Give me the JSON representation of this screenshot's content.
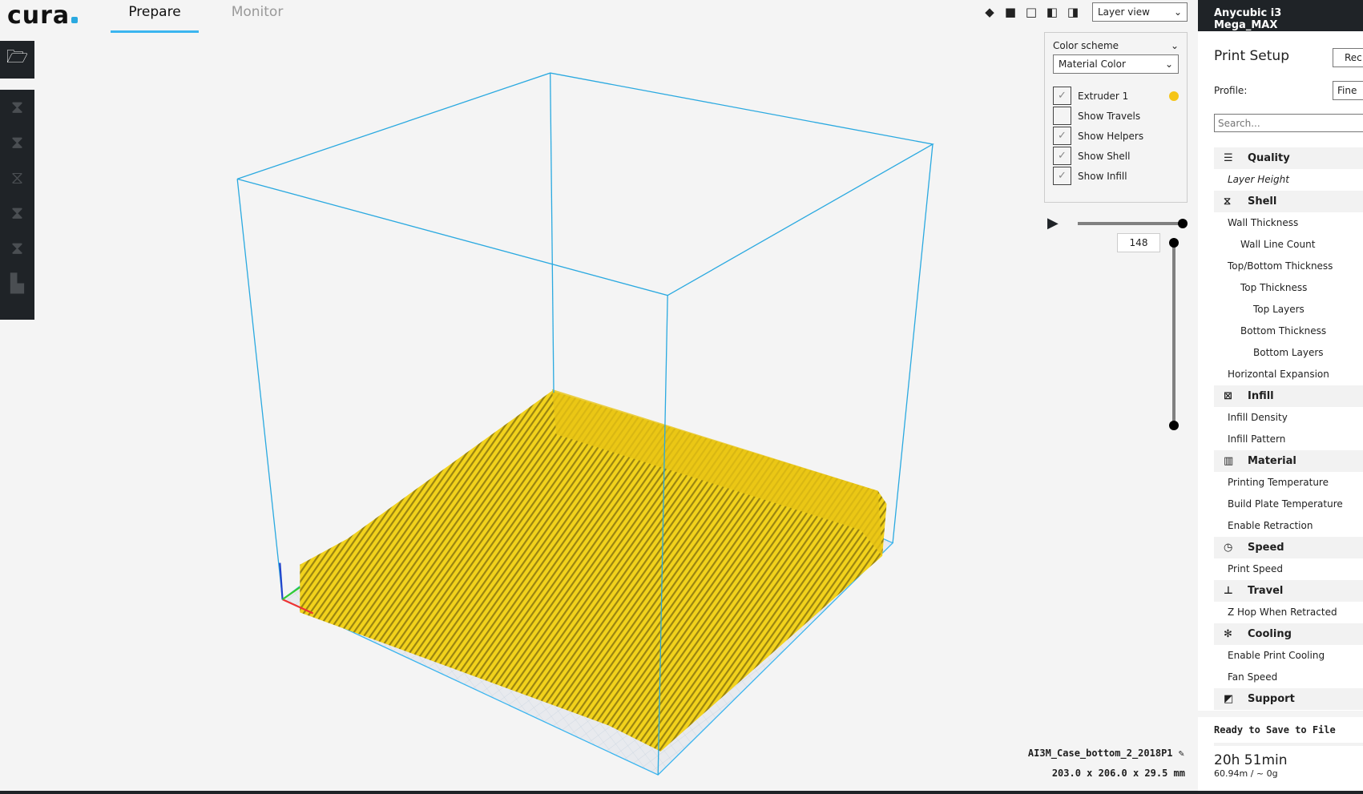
{
  "header": {
    "logo": "cura",
    "tabs": [
      {
        "label": "Prepare",
        "active": true
      },
      {
        "label": "Monitor",
        "active": false
      }
    ],
    "view_mode": "Layer view"
  },
  "sidebar": {
    "tools": [
      "open-file",
      "translate",
      "scale",
      "rotate",
      "mirror",
      "per-model-settings",
      "support-blocker"
    ]
  },
  "layer_view": {
    "color_scheme_label": "Color scheme",
    "color_scheme": "Material Color",
    "options": [
      {
        "label": "Extruder 1",
        "checked": true
      },
      {
        "label": "Show Travels",
        "checked": false
      },
      {
        "label": "Show Helpers",
        "checked": true
      },
      {
        "label": "Show Shell",
        "checked": true
      },
      {
        "label": "Show Infill",
        "checked": true
      }
    ],
    "extruder_color": "#f5c518",
    "current_layer": "148"
  },
  "model": {
    "name": "AI3M_Case_bottom_2_2018P1",
    "dimensions": "203.0 x 206.0 x 29.5 mm"
  },
  "panel": {
    "printer": "Anycubic i3 Mega_MAX",
    "title": "Print Setup",
    "recommended_button": "Rec",
    "profile_label": "Profile:",
    "profile_value": "Fine",
    "search_placeholder": "Search...",
    "settings": [
      {
        "type": "cat",
        "label": "Quality",
        "icon": "☰"
      },
      {
        "type": "item",
        "label": "Layer Height",
        "indent": 0,
        "italic": true
      },
      {
        "type": "cat",
        "label": "Shell",
        "icon": "⧖"
      },
      {
        "type": "item",
        "label": "Wall Thickness",
        "indent": 0
      },
      {
        "type": "item",
        "label": "Wall Line Count",
        "indent": 1
      },
      {
        "type": "item",
        "label": "Top/Bottom Thickness",
        "indent": 0
      },
      {
        "type": "item",
        "label": "Top Thickness",
        "indent": 1
      },
      {
        "type": "item",
        "label": "Top Layers",
        "indent": 2
      },
      {
        "type": "item",
        "label": "Bottom Thickness",
        "indent": 1
      },
      {
        "type": "item",
        "label": "Bottom Layers",
        "indent": 2
      },
      {
        "type": "item",
        "label": "Horizontal Expansion",
        "indent": 0
      },
      {
        "type": "cat",
        "label": "Infill",
        "icon": "⊠"
      },
      {
        "type": "item",
        "label": "Infill Density",
        "indent": 0
      },
      {
        "type": "item",
        "label": "Infill Pattern",
        "indent": 0
      },
      {
        "type": "cat",
        "label": "Material",
        "icon": "▥"
      },
      {
        "type": "item",
        "label": "Printing Temperature",
        "indent": 0
      },
      {
        "type": "item",
        "label": "Build Plate Temperature",
        "indent": 0
      },
      {
        "type": "item",
        "label": "Enable Retraction",
        "indent": 0
      },
      {
        "type": "cat",
        "label": "Speed",
        "icon": "◷"
      },
      {
        "type": "item",
        "label": "Print Speed",
        "indent": 0
      },
      {
        "type": "cat",
        "label": "Travel",
        "icon": "⊥"
      },
      {
        "type": "item",
        "label": "Z Hop When Retracted",
        "indent": 0
      },
      {
        "type": "cat",
        "label": "Cooling",
        "icon": "✻"
      },
      {
        "type": "item",
        "label": "Enable Print Cooling",
        "indent": 0
      },
      {
        "type": "item",
        "label": "Fan Speed",
        "indent": 0
      },
      {
        "type": "cat",
        "label": "Support",
        "icon": "◩"
      }
    ],
    "status": "Ready to Save to File",
    "print_time": "20h 51min",
    "material_usage": "60.94m / ~ 0g"
  }
}
